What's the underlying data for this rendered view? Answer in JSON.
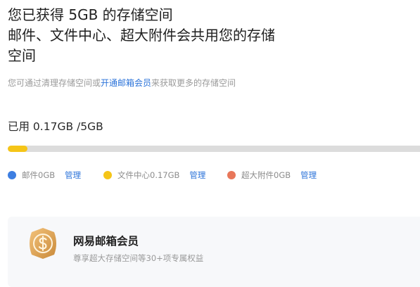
{
  "header": {
    "line1": "您已获得 5GB 的存储空间",
    "line2": "邮件、文件中心、超大附件会共用您的存储",
    "line3": "空间"
  },
  "hint": {
    "before": "您可通过清理存储空间或",
    "link": "开通邮箱会员",
    "after": "来获取更多的存储空间"
  },
  "usage": {
    "text": "已用 0.17GB /5GB",
    "used_fraction": 0.047,
    "fill_color": "#f5c518",
    "track_color": "#dcdcdc"
  },
  "legend": [
    {
      "label": "邮件0GB",
      "color": "#3d7ee1",
      "manage": "管理"
    },
    {
      "label": "文件中心0.17GB",
      "color": "#f5c518",
      "manage": "管理"
    },
    {
      "label": "超大附件0GB",
      "color": "#e8775a",
      "manage": "管理"
    }
  ],
  "promo": {
    "title": "网易邮箱会员",
    "subtitle": "尊享超大存储空间等30+项专属权益",
    "icon": "gold-coin-badge-icon"
  }
}
